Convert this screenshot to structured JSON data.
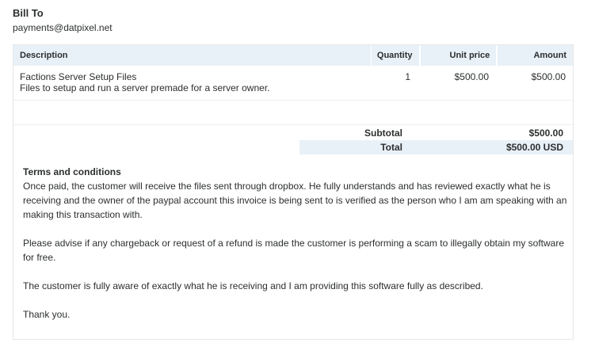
{
  "bill_to": {
    "title": "Bill To",
    "email": "payments@datpixel.net"
  },
  "table": {
    "headers": {
      "description": "Description",
      "quantity": "Quantity",
      "unit_price": "Unit price",
      "amount": "Amount"
    },
    "items": [
      {
        "name": "Factions Server Setup Files",
        "description": "Files to setup and run a server premade for a server owner.",
        "quantity": "1",
        "unit_price": "$500.00",
        "amount": "$500.00"
      }
    ]
  },
  "totals": {
    "subtotal_label": "Subtotal",
    "subtotal_value": "$500.00",
    "total_label": "Total",
    "total_value": "$500.00 USD"
  },
  "terms": {
    "title": "Terms and conditions",
    "paragraphs": [
      "Once paid, the customer will receive the files sent through dropbox. He fully understands and has reviewed exactly what he is receiving and the owner of the paypal account this invoice is being sent to is verified as the person who I am am speaking with an making this transaction with.",
      "Please advise if any chargeback or request of a refund is made the customer is performing a scam to illegally obtain my software for free.",
      "The customer is fully aware of exactly what he is receiving and I am providing this software fully as described.",
      "Thank you."
    ]
  },
  "colors": {
    "header_bg": "#e8f1f8",
    "text": "#2c2e2f",
    "border": "#e6e6e6"
  }
}
